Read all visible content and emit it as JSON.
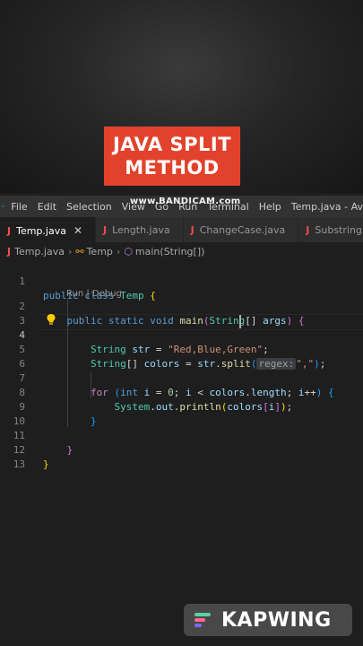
{
  "overlay": {
    "title_line1": "JAVA SPLIT",
    "title_line2": "METHOD",
    "recorder_watermark": "www.BANDICAM.com",
    "editor_watermark": "KAPWING"
  },
  "menubar": {
    "items": [
      "File",
      "Edit",
      "Selection",
      "View",
      "Go",
      "Run",
      "Terminal",
      "Help"
    ],
    "window_title": "Temp.java - Av"
  },
  "tabs": [
    {
      "label": "Temp.java",
      "active": true
    },
    {
      "label": "Length.java",
      "active": false
    },
    {
      "label": "ChangeCase.java",
      "active": false
    },
    {
      "label": "Substring.j",
      "active": false
    }
  ],
  "breadcrumb": {
    "file": "Temp.java",
    "class": "Temp",
    "method": "main(String[])"
  },
  "code_lens": "Run | Debug",
  "line_numbers": [
    "1",
    "2",
    "3",
    "4",
    "5",
    "6",
    "7",
    "8",
    "9",
    "10",
    "11",
    "12",
    "13"
  ],
  "code": {
    "l1_public": "public",
    "l1_class": "class",
    "l1_name": "Temp",
    "l2_public": "public",
    "l2_static": "static",
    "l2_void": "void",
    "l2_main": "main",
    "l2_type": "String",
    "l2_args": "args",
    "l4_type": "String",
    "l4_var": "str",
    "l4_value": "\"Red,Blue,Green\"",
    "l5_type": "String",
    "l5_var": "colors",
    "l5_obj": "str",
    "l5_fn": "split",
    "l5_hint": "regex:",
    "l5_arg": "\",\"",
    "l7_for": "for",
    "l7_int": "int",
    "l7_i": "i",
    "l7_zero": "0",
    "l7_colors": "colors",
    "l7_length": "length",
    "l8_system": "System",
    "l8_out": "out",
    "l8_println": "println",
    "l8_colors": "colors",
    "l8_i": "i"
  },
  "colors": {
    "title_bg": "#e2422b",
    "keyword": "#569cd6",
    "control": "#c586c0",
    "type": "#4ec9b0",
    "variable": "#9cdcfe",
    "function": "#dcdcaa",
    "string": "#ce9178",
    "java_icon": "#f14c4c"
  }
}
